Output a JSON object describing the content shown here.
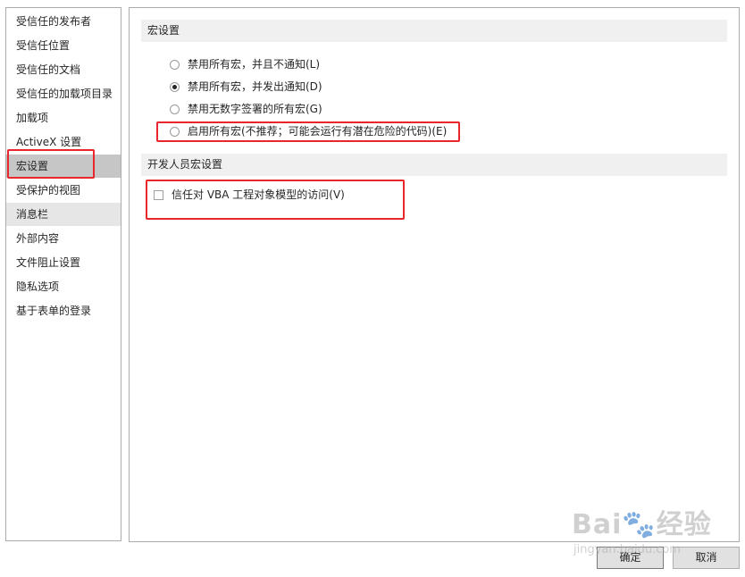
{
  "sidebar": {
    "items": [
      {
        "label": "受信任的发布者"
      },
      {
        "label": "受信任位置"
      },
      {
        "label": "受信任的文档"
      },
      {
        "label": "受信任的加载项目录"
      },
      {
        "label": "加载项"
      },
      {
        "label": "ActiveX 设置"
      },
      {
        "label": "宏设置"
      },
      {
        "label": "受保护的视图"
      },
      {
        "label": "消息栏"
      },
      {
        "label": "外部内容"
      },
      {
        "label": "文件阻止设置"
      },
      {
        "label": "隐私选项"
      },
      {
        "label": "基于表单的登录"
      }
    ],
    "selected": "宏设置"
  },
  "macro_section": {
    "title": "宏设置",
    "options": [
      {
        "label": "禁用所有宏，并且不通知(L)",
        "checked": false
      },
      {
        "label": "禁用所有宏，并发出通知(D)",
        "checked": true
      },
      {
        "label": "禁用无数字签署的所有宏(G)",
        "checked": false
      },
      {
        "label": "启用所有宏(不推荐；可能会运行有潜在危险的代码)(E)",
        "checked": false
      }
    ]
  },
  "developer_section": {
    "title": "开发人员宏设置",
    "vba_label": "信任对 VBA 工程对象模型的访问(V)",
    "vba_checked": false
  },
  "buttons": {
    "ok": "确定",
    "cancel": "取消"
  },
  "watermark": {
    "main": "Bai🐾经验",
    "sub": "jingyan.baidu.com"
  },
  "colors": {
    "highlight": "#e8262c",
    "selected_bg": "#c6c6c6",
    "section_bg": "#f0f0f0"
  }
}
